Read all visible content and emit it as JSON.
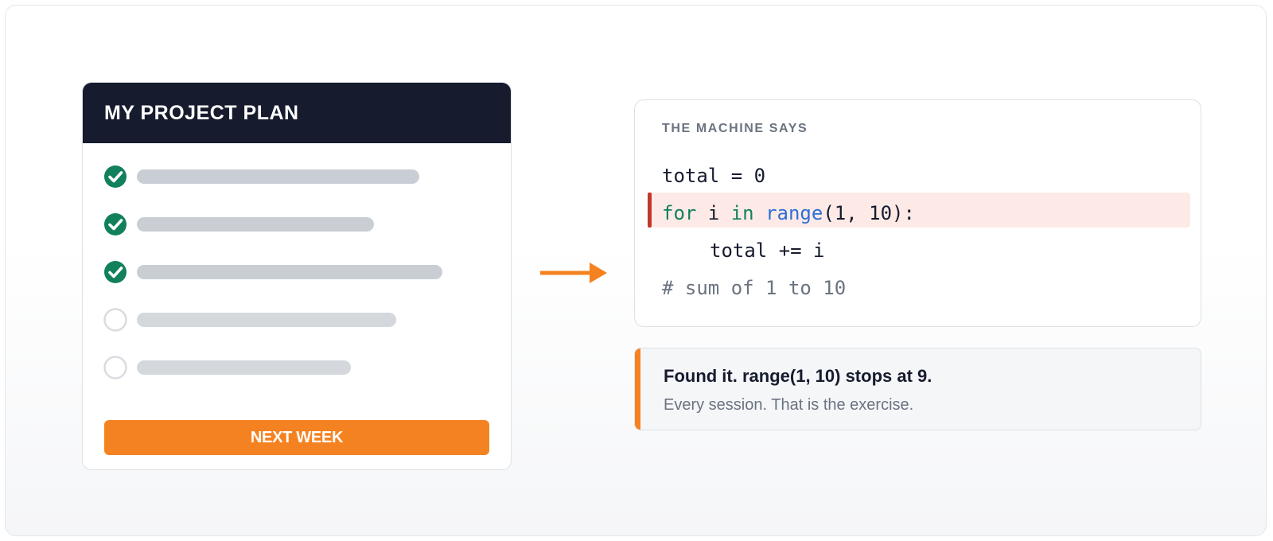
{
  "plan_card": {
    "title": "MY PROJECT PLAN",
    "tasks": [
      {
        "done": true,
        "bar_fraction": 0.74
      },
      {
        "done": true,
        "bar_fraction": 0.62
      },
      {
        "done": true,
        "bar_fraction": 0.8
      },
      {
        "done": false,
        "bar_fraction": 0.68
      },
      {
        "done": false,
        "bar_fraction": 0.56
      }
    ],
    "next_button_label": "NEXT WEEK"
  },
  "code_panel": {
    "label": "THE MACHINE SAYS",
    "lines": {
      "line1": "total = 0",
      "line2": {
        "kw_for": "for",
        "var": " i ",
        "kw_in": "in",
        "space": " ",
        "fn": "range",
        "args": "(1, 10):"
      },
      "line3": "total += i",
      "line4": "# sum of 1 to 10"
    },
    "highlighted_line": 2
  },
  "note": {
    "title": "Found it. range(1, 10) stops at 9.",
    "subtitle": "Every session. That is the exercise."
  },
  "colors": {
    "header_bg": "#161b2e",
    "accent_orange": "#f58220",
    "check_green": "#12805c",
    "highlight_red": "#c0392b",
    "keyword_green": "#12805c",
    "builtin_blue": "#2f6fd6"
  }
}
